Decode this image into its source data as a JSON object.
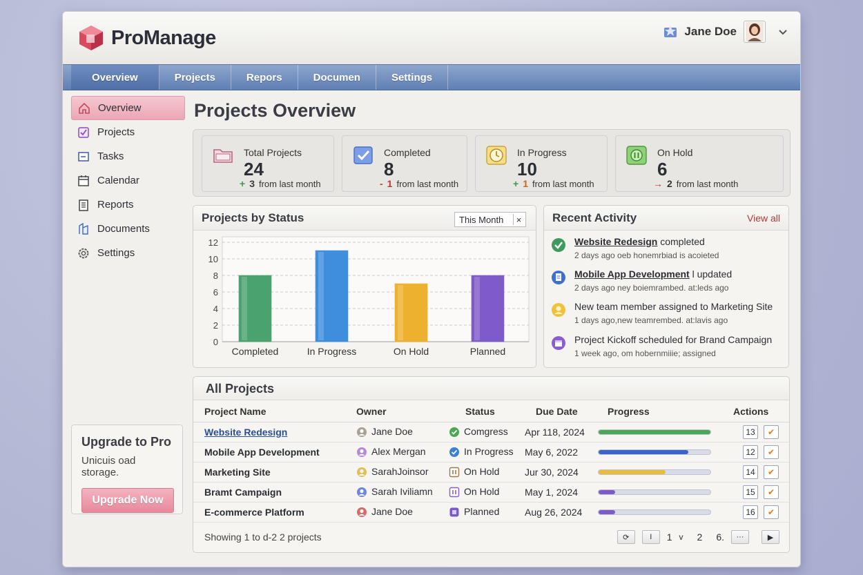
{
  "app": {
    "title": "ProManage"
  },
  "user": {
    "name": "Jane Doe"
  },
  "nav": {
    "tabs": [
      {
        "label": "Overview"
      },
      {
        "label": "Projects"
      },
      {
        "label": "Repors"
      },
      {
        "label": "Documen"
      },
      {
        "label": "Settings"
      }
    ]
  },
  "sidebar": {
    "items": [
      {
        "label": "Overview",
        "icon": "home-icon"
      },
      {
        "label": "Projects",
        "icon": "projects-icon"
      },
      {
        "label": "Tasks",
        "icon": "tasks-icon"
      },
      {
        "label": "Calendar",
        "icon": "calendar-icon"
      },
      {
        "label": "Reports",
        "icon": "reports-icon"
      },
      {
        "label": "Documents",
        "icon": "documents-icon"
      },
      {
        "label": "Settings",
        "icon": "gear-icon"
      }
    ],
    "upgrade": {
      "title": "Upgrade to Pro",
      "text": "Unicuis oad storage.",
      "button": "Upgrade Now"
    }
  },
  "main": {
    "title": "Projects Overview"
  },
  "stats": [
    {
      "label": "Total Projects",
      "value": "24",
      "sign": "+",
      "delta": "3",
      "trend_text": "from last month",
      "color": "#f3d3df"
    },
    {
      "label": "Completed",
      "value": "8",
      "sign": "-",
      "delta": "1",
      "trend_text": "from last month",
      "color": "#dde1f2"
    },
    {
      "label": "In Progress",
      "value": "10",
      "sign": "+",
      "delta": "1",
      "trend_text": "from last month",
      "color": "#f5ecc9"
    },
    {
      "label": "On Hold",
      "value": "6",
      "sign": "→",
      "delta": "2",
      "trend_text": "from last month",
      "color": "#dde9dc"
    }
  ],
  "chart_panel": {
    "title": "Projects by Status",
    "filter": "This Month",
    "filter_clear": "×"
  },
  "chart_data": {
    "type": "bar",
    "categories": [
      "Completed",
      "In Progress",
      "On Hold",
      "Planned"
    ],
    "values": [
      8,
      11,
      7,
      8
    ],
    "colors": [
      "#4aa26e",
      "#3f8ede",
      "#eeb12f",
      "#7f5bc9"
    ],
    "yticks": [
      0,
      2,
      4,
      6,
      8,
      10,
      12
    ],
    "ylim": [
      0,
      12
    ],
    "grid": true
  },
  "activity": {
    "title": "Recent Activity",
    "view_all": "View all",
    "items": [
      {
        "link": "Website Redesign",
        "rest": " completed",
        "sub": "2 days ago oeb honemrbiad is acoieted",
        "color": "#3f9a5c"
      },
      {
        "link": "Mobile App Development",
        "rest": " l updated",
        "sub": "2 days ago ney boiemrambed. at:leds ago",
        "color": "#3f6fd0"
      },
      {
        "link": "",
        "rest": "New team member assigned to Marketing Site",
        "sub": "1 days ago,new teamrembed. at:lavis ago",
        "color": "#f0c23a"
      },
      {
        "link": "",
        "rest": "Project Kickoff scheduled for Brand Campaign",
        "sub": "1 week ago, om hobernmiiie; assigned",
        "color": "#8a5ed0"
      }
    ]
  },
  "table": {
    "title": "All Projects",
    "headers": [
      "Project Name",
      "Owner",
      "Status",
      "Due Date",
      "Progress",
      "Actions"
    ],
    "rows": [
      {
        "name": "Website Redesign",
        "owner": "Jane Doe",
        "status": "Comgress",
        "due": "Apr 118, 2024",
        "progress": 1.0,
        "bar": "#4aa755",
        "num": "13",
        "status_icon": "check-circle-icon",
        "status_color": "#4aa755",
        "owner_color": "#9a8a7a"
      },
      {
        "name": "Mobile App Development",
        "owner": "Alex Mergan",
        "status": "In Progress",
        "due": "May 6, 2022",
        "progress": 0.8,
        "bar": "#3b64c9",
        "num": "12",
        "status_icon": "check-circle-icon",
        "status_color": "#3b7fd8",
        "owner_color": "#a66ed0"
      },
      {
        "name": "Marketing Site",
        "owner": "SarahJoinsor",
        "status": "On Hold",
        "due": "Jur 30, 2024",
        "progress": 0.6,
        "bar": "#e9bd3a",
        "num": "14",
        "status_icon": "pause-icon",
        "status_color": "#a07a40",
        "owner_color": "#e0b030"
      },
      {
        "name": "Bramt Campaign",
        "owner": "Sarah Iviliamn",
        "status": "On Hold",
        "due": "May 1, 2024",
        "progress": 0.15,
        "bar": "#7e5cc8",
        "num": "15",
        "status_icon": "pause-icon",
        "status_color": "#8a5ec9",
        "owner_color": "#4a6ad8"
      },
      {
        "name": "E-commerce Platform",
        "owner": "Jane Doe",
        "status": "Planned",
        "due": "Aug 26, 2024",
        "progress": 0.15,
        "bar": "#7e5cc8",
        "num": "16",
        "status_icon": "square-icon",
        "status_color": "#7a5ac8",
        "owner_color": "#d04848"
      }
    ],
    "showing": "Showing 1 to d-2 2 projects",
    "pager": [
      "1",
      "v",
      "2",
      "6.",
      "···"
    ]
  }
}
